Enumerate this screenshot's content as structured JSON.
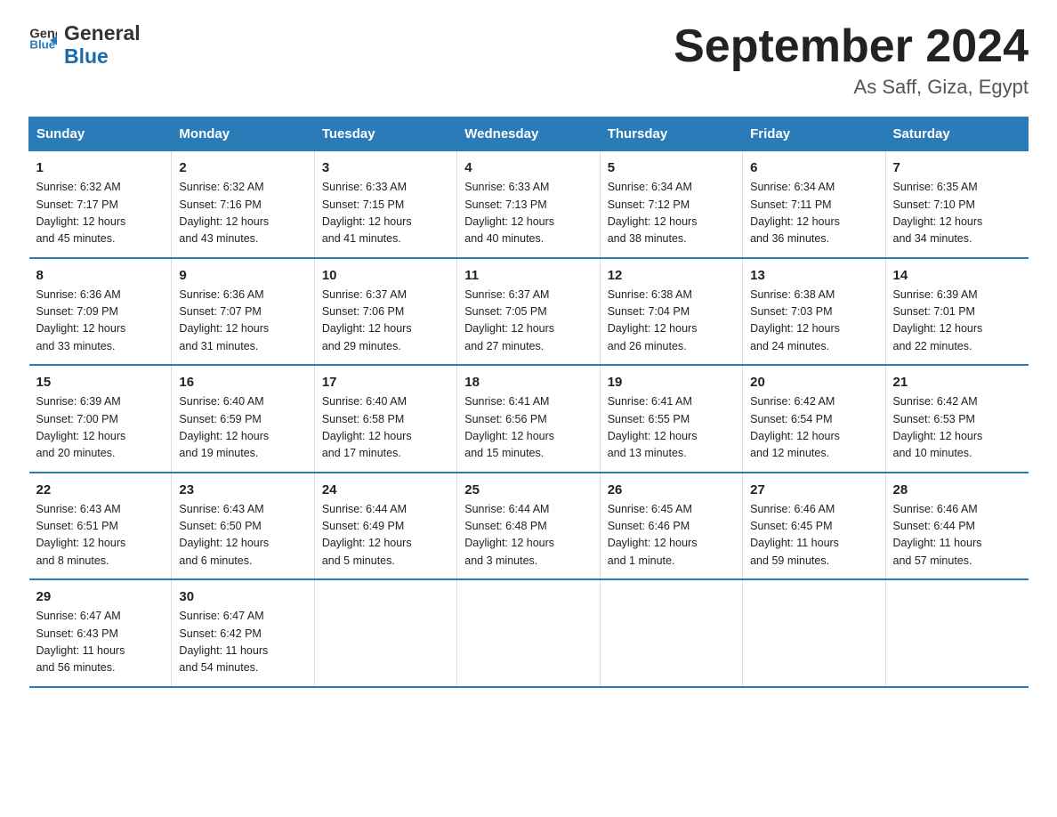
{
  "header": {
    "logo_text_general": "General",
    "logo_text_blue": "Blue",
    "month_title": "September 2024",
    "location": "As Saff, Giza, Egypt"
  },
  "weekdays": [
    "Sunday",
    "Monday",
    "Tuesday",
    "Wednesday",
    "Thursday",
    "Friday",
    "Saturday"
  ],
  "weeks": [
    [
      {
        "day": "1",
        "sunrise": "6:32 AM",
        "sunset": "7:17 PM",
        "daylight": "12 hours and 45 minutes."
      },
      {
        "day": "2",
        "sunrise": "6:32 AM",
        "sunset": "7:16 PM",
        "daylight": "12 hours and 43 minutes."
      },
      {
        "day": "3",
        "sunrise": "6:33 AM",
        "sunset": "7:15 PM",
        "daylight": "12 hours and 41 minutes."
      },
      {
        "day": "4",
        "sunrise": "6:33 AM",
        "sunset": "7:13 PM",
        "daylight": "12 hours and 40 minutes."
      },
      {
        "day": "5",
        "sunrise": "6:34 AM",
        "sunset": "7:12 PM",
        "daylight": "12 hours and 38 minutes."
      },
      {
        "day": "6",
        "sunrise": "6:34 AM",
        "sunset": "7:11 PM",
        "daylight": "12 hours and 36 minutes."
      },
      {
        "day": "7",
        "sunrise": "6:35 AM",
        "sunset": "7:10 PM",
        "daylight": "12 hours and 34 minutes."
      }
    ],
    [
      {
        "day": "8",
        "sunrise": "6:36 AM",
        "sunset": "7:09 PM",
        "daylight": "12 hours and 33 minutes."
      },
      {
        "day": "9",
        "sunrise": "6:36 AM",
        "sunset": "7:07 PM",
        "daylight": "12 hours and 31 minutes."
      },
      {
        "day": "10",
        "sunrise": "6:37 AM",
        "sunset": "7:06 PM",
        "daylight": "12 hours and 29 minutes."
      },
      {
        "day": "11",
        "sunrise": "6:37 AM",
        "sunset": "7:05 PM",
        "daylight": "12 hours and 27 minutes."
      },
      {
        "day": "12",
        "sunrise": "6:38 AM",
        "sunset": "7:04 PM",
        "daylight": "12 hours and 26 minutes."
      },
      {
        "day": "13",
        "sunrise": "6:38 AM",
        "sunset": "7:03 PM",
        "daylight": "12 hours and 24 minutes."
      },
      {
        "day": "14",
        "sunrise": "6:39 AM",
        "sunset": "7:01 PM",
        "daylight": "12 hours and 22 minutes."
      }
    ],
    [
      {
        "day": "15",
        "sunrise": "6:39 AM",
        "sunset": "7:00 PM",
        "daylight": "12 hours and 20 minutes."
      },
      {
        "day": "16",
        "sunrise": "6:40 AM",
        "sunset": "6:59 PM",
        "daylight": "12 hours and 19 minutes."
      },
      {
        "day": "17",
        "sunrise": "6:40 AM",
        "sunset": "6:58 PM",
        "daylight": "12 hours and 17 minutes."
      },
      {
        "day": "18",
        "sunrise": "6:41 AM",
        "sunset": "6:56 PM",
        "daylight": "12 hours and 15 minutes."
      },
      {
        "day": "19",
        "sunrise": "6:41 AM",
        "sunset": "6:55 PM",
        "daylight": "12 hours and 13 minutes."
      },
      {
        "day": "20",
        "sunrise": "6:42 AM",
        "sunset": "6:54 PM",
        "daylight": "12 hours and 12 minutes."
      },
      {
        "day": "21",
        "sunrise": "6:42 AM",
        "sunset": "6:53 PM",
        "daylight": "12 hours and 10 minutes."
      }
    ],
    [
      {
        "day": "22",
        "sunrise": "6:43 AM",
        "sunset": "6:51 PM",
        "daylight": "12 hours and 8 minutes."
      },
      {
        "day": "23",
        "sunrise": "6:43 AM",
        "sunset": "6:50 PM",
        "daylight": "12 hours and 6 minutes."
      },
      {
        "day": "24",
        "sunrise": "6:44 AM",
        "sunset": "6:49 PM",
        "daylight": "12 hours and 5 minutes."
      },
      {
        "day": "25",
        "sunrise": "6:44 AM",
        "sunset": "6:48 PM",
        "daylight": "12 hours and 3 minutes."
      },
      {
        "day": "26",
        "sunrise": "6:45 AM",
        "sunset": "6:46 PM",
        "daylight": "12 hours and 1 minute."
      },
      {
        "day": "27",
        "sunrise": "6:46 AM",
        "sunset": "6:45 PM",
        "daylight": "11 hours and 59 minutes."
      },
      {
        "day": "28",
        "sunrise": "6:46 AM",
        "sunset": "6:44 PM",
        "daylight": "11 hours and 57 minutes."
      }
    ],
    [
      {
        "day": "29",
        "sunrise": "6:47 AM",
        "sunset": "6:43 PM",
        "daylight": "11 hours and 56 minutes."
      },
      {
        "day": "30",
        "sunrise": "6:47 AM",
        "sunset": "6:42 PM",
        "daylight": "11 hours and 54 minutes."
      },
      null,
      null,
      null,
      null,
      null
    ]
  ],
  "labels": {
    "sunrise": "Sunrise:",
    "sunset": "Sunset:",
    "daylight": "Daylight:"
  }
}
